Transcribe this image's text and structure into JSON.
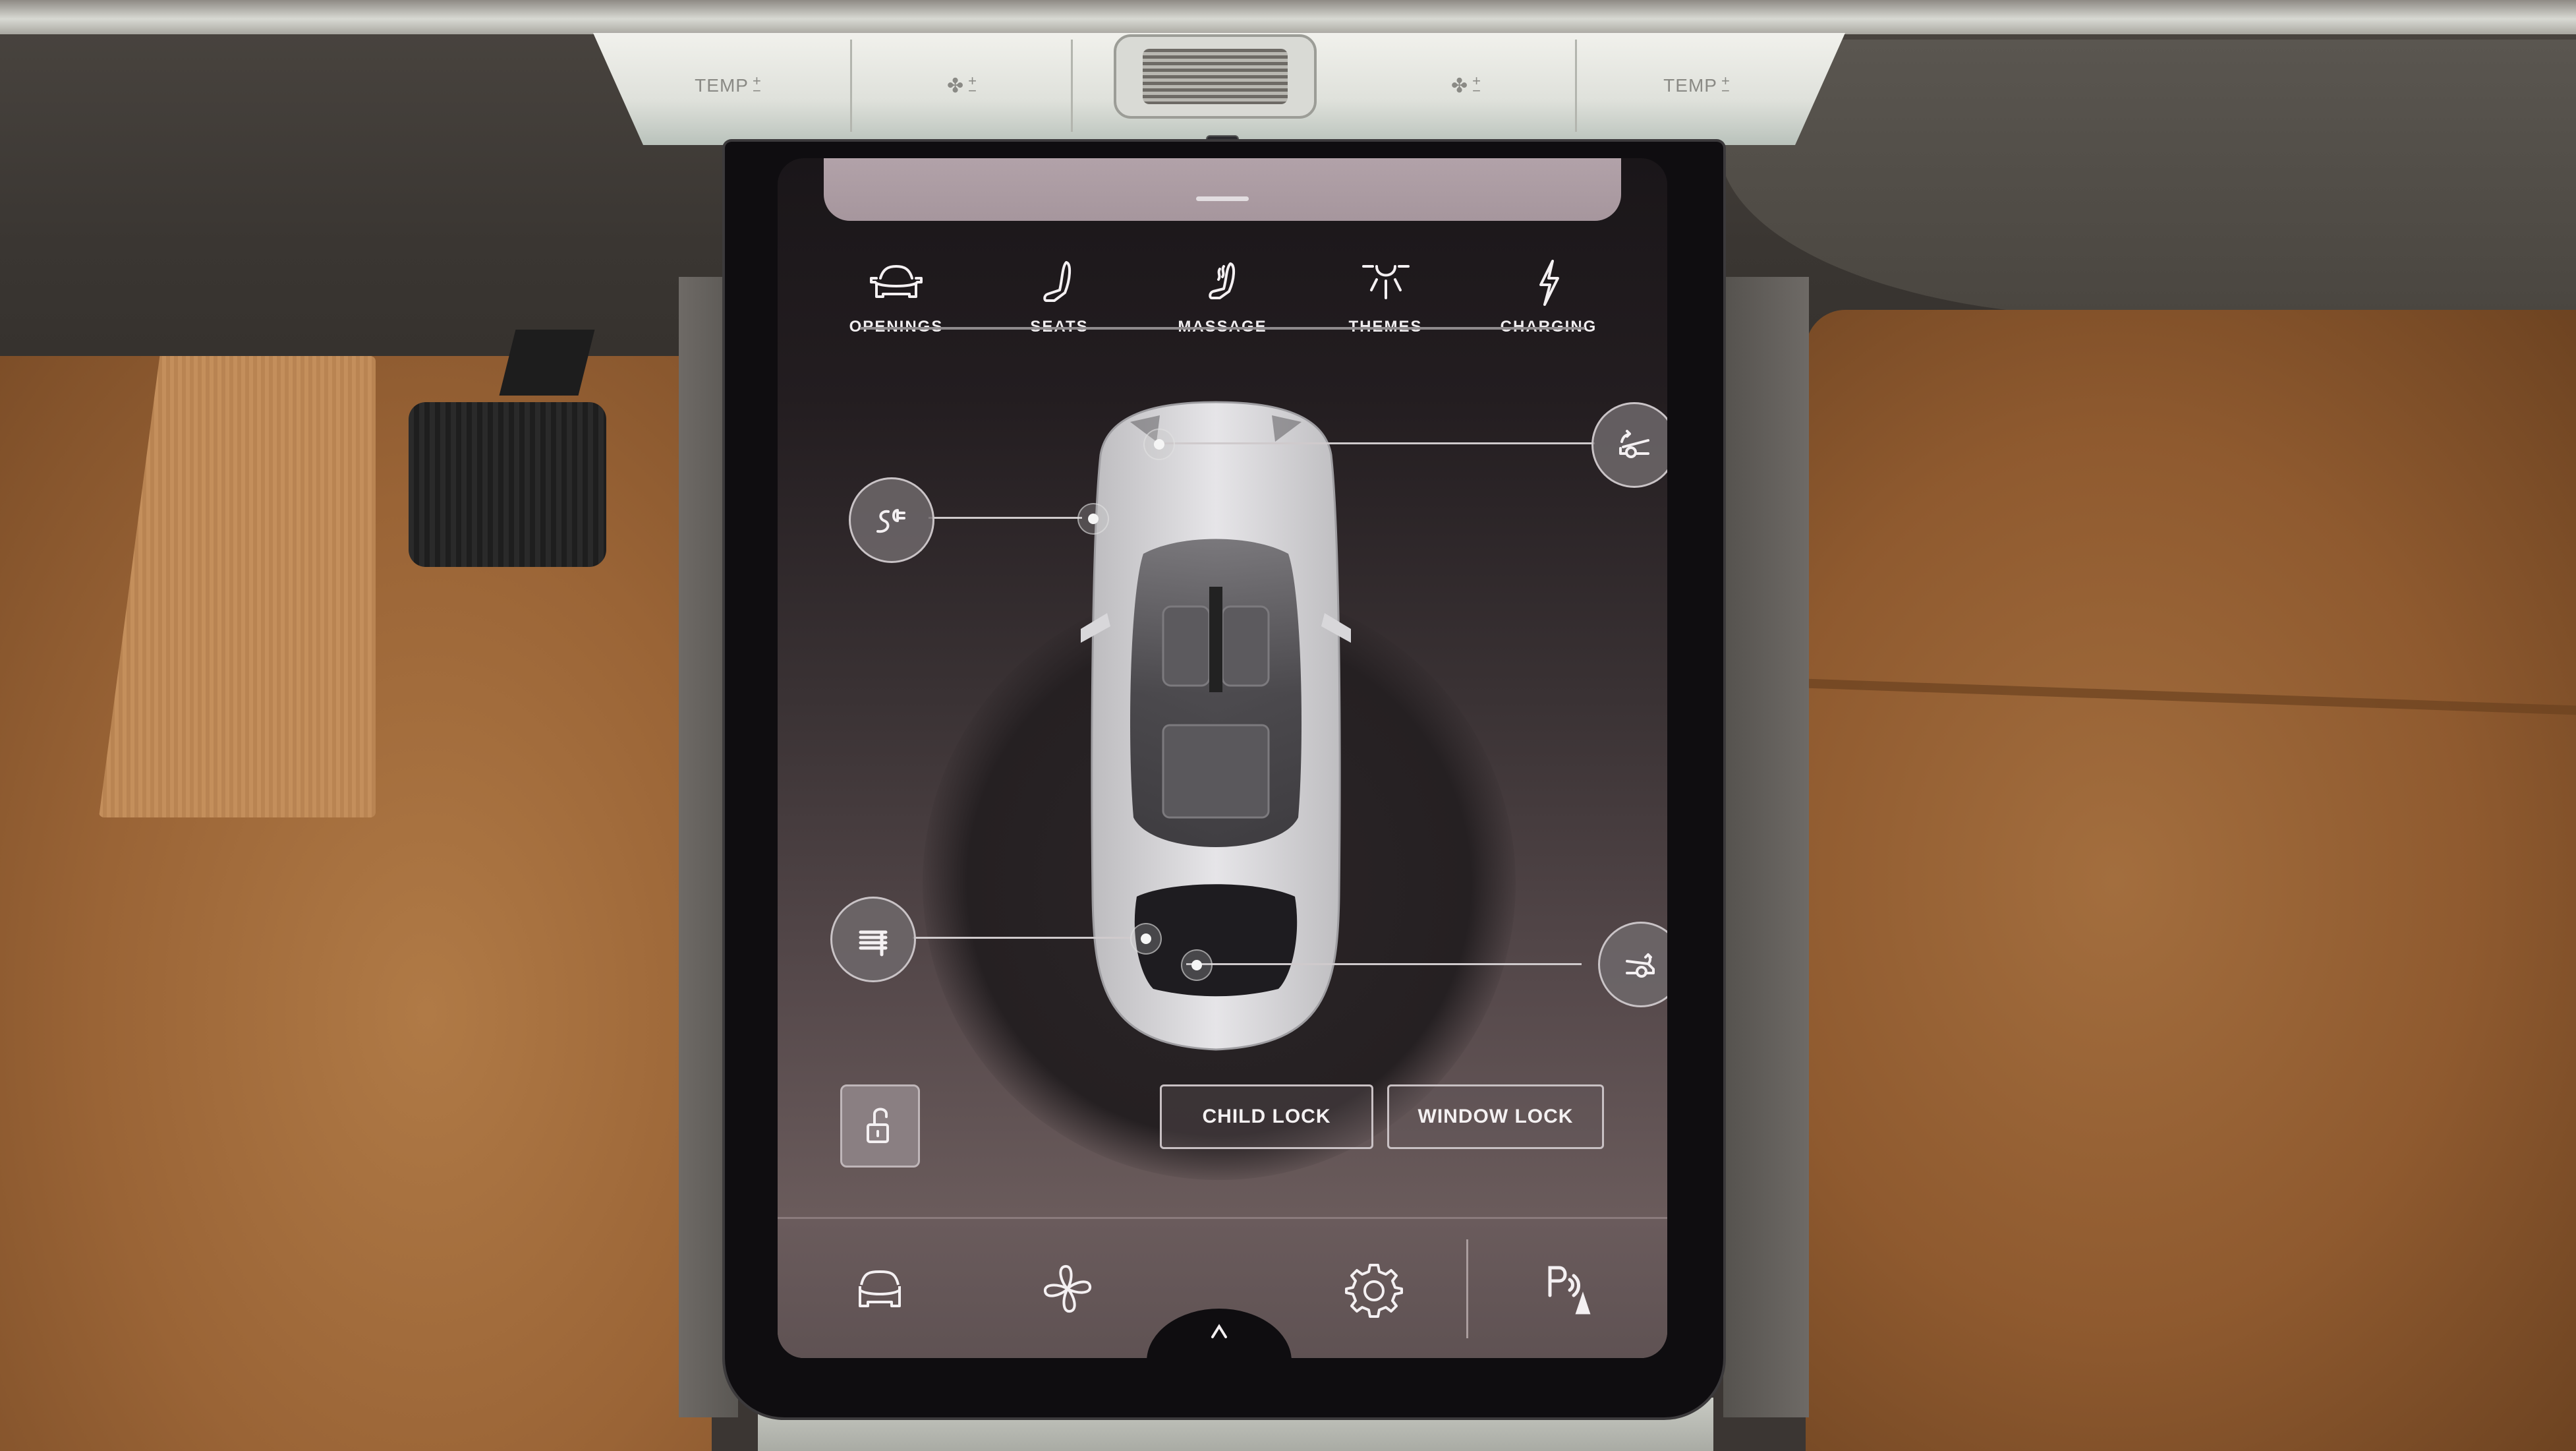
{
  "hvac": {
    "left_temp": {
      "label": "TEMP",
      "plus": "+",
      "minus": "−"
    },
    "left_fan": {
      "icon": "fan-icon",
      "plus": "+",
      "minus": "−"
    },
    "right_fan": {
      "icon": "fan-icon",
      "plus": "+",
      "minus": "−"
    },
    "right_temp": {
      "label": "TEMP",
      "plus": "+",
      "minus": "−"
    }
  },
  "tabs": [
    {
      "label": "OPENINGS",
      "icon": "car-front-icon",
      "active": true
    },
    {
      "label": "SEATS",
      "icon": "seat-icon",
      "active": false
    },
    {
      "label": "MASSAGE",
      "icon": "massage-seat-icon",
      "active": false
    },
    {
      "label": "THEMES",
      "icon": "ambient-light-icon",
      "active": false
    },
    {
      "label": "CHARGING",
      "icon": "lightning-icon",
      "active": false
    }
  ],
  "openings": {
    "charge_port": {
      "icon": "charge-port-icon"
    },
    "frunk": {
      "icon": "frunk-open-icon"
    },
    "sunshade": {
      "icon": "sunshade-icon"
    },
    "trunk": {
      "icon": "trunk-open-icon"
    },
    "lock_state": "unlocked"
  },
  "buttons": {
    "child_lock": "CHILD LOCK",
    "window_lock": "WINDOW LOCK"
  },
  "dock": {
    "items": [
      {
        "name": "vehicle",
        "icon": "car-icon"
      },
      {
        "name": "climate",
        "icon": "fan-icon"
      },
      {
        "name": "settings",
        "icon": "gear-icon"
      },
      {
        "name": "parking",
        "icon": "parking-sensor-icon",
        "label": "P"
      }
    ]
  },
  "colors": {
    "screen_text": "#f1eef0",
    "carpet": "#9a6436",
    "trim": "#dfe1db"
  }
}
